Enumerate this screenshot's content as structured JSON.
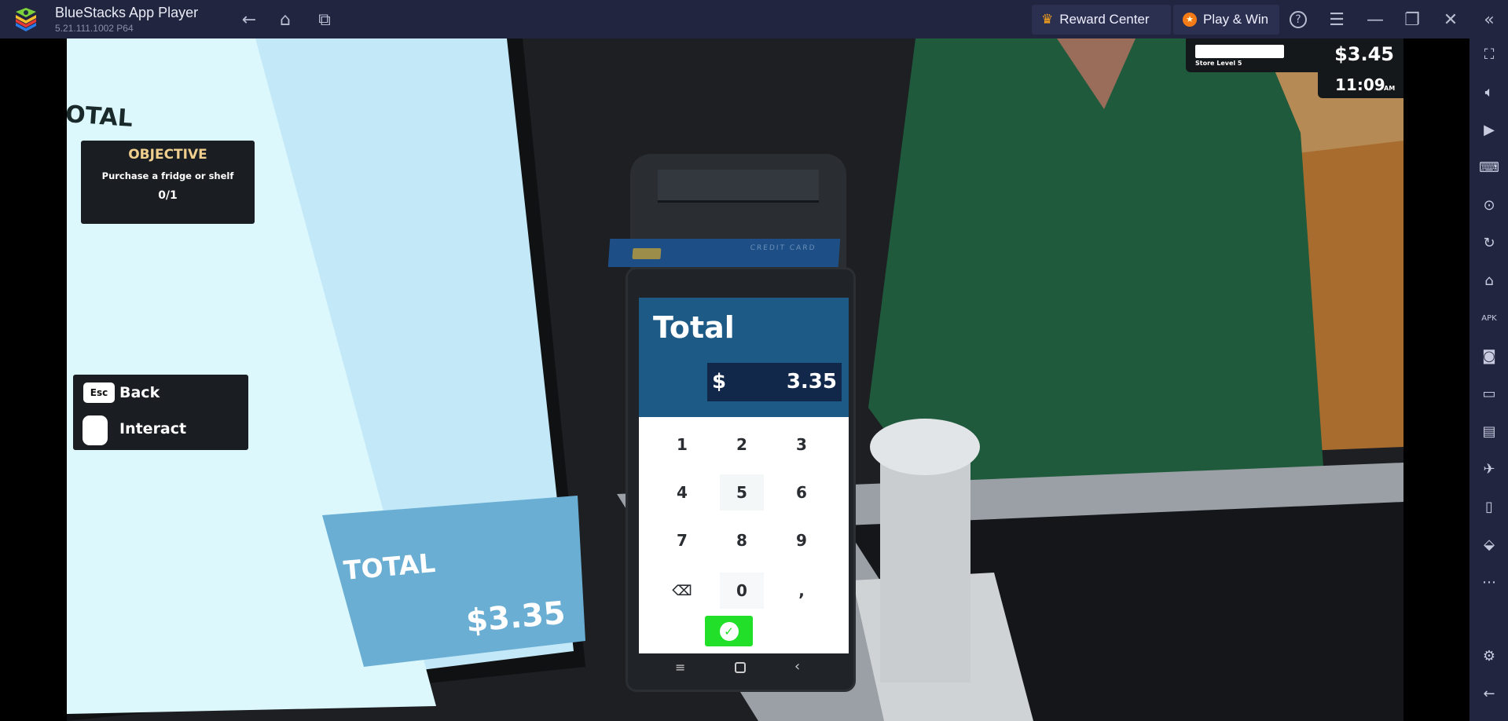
{
  "titlebar": {
    "app_name": "BlueStacks App Player",
    "version": "5.21.111.1002  P64",
    "reward_center": "Reward Center",
    "play_win": "Play & Win"
  },
  "hud": {
    "store_level": "Store Level 5",
    "money": "$3.45",
    "time": "11:09",
    "time_suffix": "AM",
    "level_progress": 1.0
  },
  "objective": {
    "title": "OBJECTIVE",
    "description": "Purchase a fridge or shelf",
    "progress": "0/1"
  },
  "controls": {
    "esc_key": "Esc",
    "back": "Back",
    "interact": "Interact"
  },
  "monitor": {
    "header_partial": "OTAL",
    "total_label": "TOTAL",
    "total_value": "$3.35"
  },
  "terminal": {
    "card_label": "CREDIT CARD",
    "title": "Total",
    "currency": "$",
    "amount": "3.35",
    "keys": [
      "1",
      "2",
      "3",
      "4",
      "5",
      "6",
      "7",
      "8",
      "9",
      "0",
      ","
    ]
  },
  "colors": {
    "titlebar": "#22253f",
    "terminal_header": "#1d5a86",
    "confirm": "#22e02a",
    "objective_title": "#f0cf8e"
  }
}
